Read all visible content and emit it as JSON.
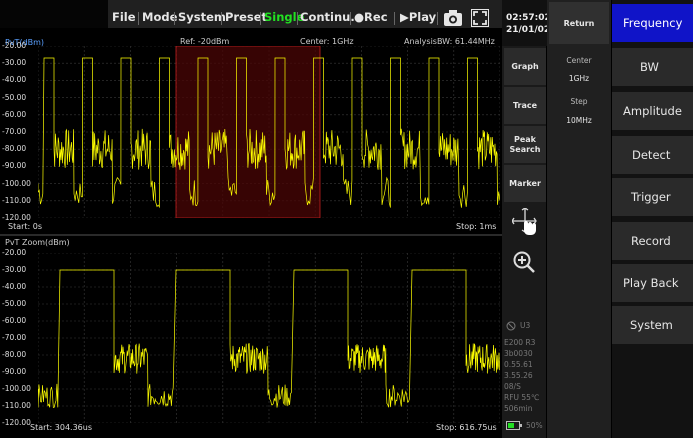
{
  "menu": [
    {
      "label": "File",
      "state": "normal"
    },
    {
      "label": "Mode",
      "state": "normal"
    },
    {
      "label": "System",
      "state": "normal"
    },
    {
      "label": "Preset",
      "state": "normal"
    },
    {
      "label": "Single",
      "state": "active"
    },
    {
      "label": "Continu.",
      "state": "normal"
    },
    {
      "label": "●Rec",
      "state": "normal"
    },
    {
      "label": "▶Play",
      "state": "normal"
    }
  ],
  "toolbar_icons": [
    "camera-icon",
    "fullscreen-icon"
  ],
  "clock": {
    "time": "02:57:02",
    "date": "21/01/02"
  },
  "top_panel": {
    "title": "PvT(dBm)",
    "ref": "Ref: -20dBm",
    "center": "Center: 1GHz",
    "analysis_bw": "AnalysisBW: 61.44MHz",
    "y_ticks": [
      "-20.00",
      "-30.00",
      "-40.00",
      "-50.00",
      "-60.00",
      "-70.00",
      "-80.00",
      "-90.00",
      "-100.00",
      "-110.00",
      "-120.00"
    ],
    "start": "Start: 0s",
    "stop": "Stop: 1ms"
  },
  "bottom_panel": {
    "title": "PvT Zoom(dBm)",
    "y_ticks": [
      "-20.00",
      "-30.00",
      "-40.00",
      "-50.00",
      "-60.00",
      "-70.00",
      "-80.00",
      "-90.00",
      "-100.00",
      "-110.00",
      "-120.00"
    ],
    "start": "Start: 304.36us",
    "stop": "Stop: 616.75us"
  },
  "side_buttons": [
    "Graph",
    "Trace",
    "Peak Search",
    "Marker"
  ],
  "side_icons": [
    "pan-touch-icon",
    "zoom-in-icon"
  ],
  "status_info": {
    "id": "U3",
    "lines": [
      "E200 R3",
      "3b0030",
      "0.55.61",
      "3.55.26",
      "08/S",
      "RFU  55℃",
      "506min"
    ],
    "battery": "50%"
  },
  "param_col": {
    "return_label": "Return",
    "center_label": "Center",
    "center_value": "1GHz",
    "step_label": "Step",
    "step_value": "10MHz"
  },
  "right_menu": [
    {
      "label": "Frequency",
      "active": true
    },
    {
      "label": "BW",
      "active": false
    },
    {
      "label": "Amplitude",
      "active": false
    },
    {
      "label": "Detect",
      "active": false
    },
    {
      "label": "Trigger",
      "active": false
    },
    {
      "label": "Record",
      "active": false
    },
    {
      "label": "Play Back",
      "active": false
    },
    {
      "label": "System",
      "active": false
    }
  ],
  "colors": {
    "trace": "#ffff00",
    "zoom_region": "#5a0808",
    "active_menu": "#1014c8",
    "active_text": "#22e022"
  }
}
